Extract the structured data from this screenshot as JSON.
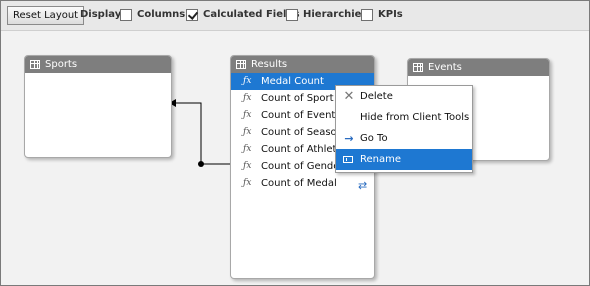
{
  "toolbar": {
    "reset_label": "Reset Layout",
    "display_label": "Display:",
    "options": [
      {
        "label": "Columns",
        "checked": false
      },
      {
        "label": "Calculated Fields",
        "checked": true
      },
      {
        "label": "Hierarchies",
        "checked": false
      },
      {
        "label": "KPIs",
        "checked": false
      }
    ]
  },
  "tables": {
    "sports": {
      "title": "Sports"
    },
    "results": {
      "title": "Results",
      "fields": [
        "Medal Count",
        "Count of Sport",
        "Count of Event",
        "Count of Season",
        "Count of Athlete",
        "Count of Gender",
        "Count of Medal"
      ],
      "selected_index": 0,
      "field_icon_text": "ƒx"
    },
    "events": {
      "title": "Events"
    }
  },
  "context_menu": {
    "items": [
      {
        "label": "Delete",
        "icon": "delete-x-icon"
      },
      {
        "label": "Hide from Client Tools",
        "icon": null
      },
      {
        "label": "Go To",
        "icon": "goto-arrow-icon"
      },
      {
        "label": "Rename",
        "icon": "rename-icon",
        "highlighted": true
      }
    ]
  },
  "colors": {
    "selection": "#1e78d2",
    "header": "#7e7e7e",
    "canvas": "#f2f2f2"
  }
}
